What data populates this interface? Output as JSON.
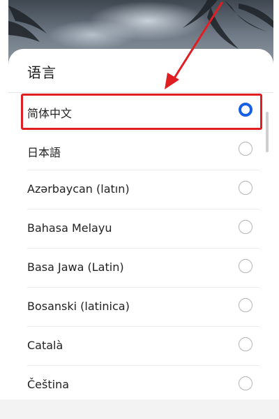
{
  "dialog": {
    "title": "语言"
  },
  "languages": [
    {
      "label": "简体中文",
      "selected": true
    },
    {
      "label": "日本語",
      "selected": false
    },
    {
      "label": "Azərbaycan (latın)",
      "selected": false
    },
    {
      "label": "Bahasa Melayu",
      "selected": false
    },
    {
      "label": "Basa Jawa (Latin)",
      "selected": false
    },
    {
      "label": "Bosanski (latinica)",
      "selected": false
    },
    {
      "label": "Català",
      "selected": false
    },
    {
      "label": "Čeština",
      "selected": false
    }
  ],
  "colors": {
    "radio_selected": "#1660e5",
    "annotation": "#e01e22"
  }
}
